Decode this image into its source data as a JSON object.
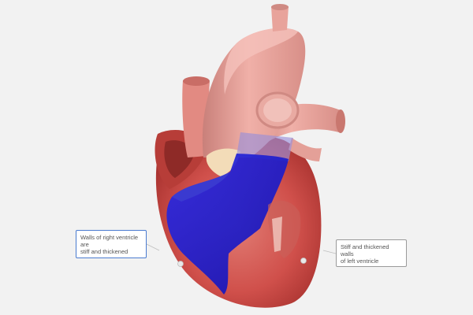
{
  "scene": {
    "background": "#f2f2f2",
    "subject": "heart-3d-model",
    "colors": {
      "myocardium": "#d45a55",
      "myocardium_dark": "#a3332f",
      "vessels": "#e8a09a",
      "vessels_shadow": "#c97a74",
      "ventricle_highlight": "#1a1ad8",
      "valve": "#f3d9b5",
      "callout_border": "#9a9a9a",
      "callout_selected_border": "#4a7bd0"
    }
  },
  "callouts": [
    {
      "id": "right-ventricle",
      "lines": [
        "Walls of right ventricle",
        "are",
        "stiff and thickened"
      ],
      "selected": true
    },
    {
      "id": "left-ventricle",
      "lines": [
        "Stiff and thickened",
        "walls",
        "of left ventricle"
      ],
      "selected": false
    }
  ]
}
